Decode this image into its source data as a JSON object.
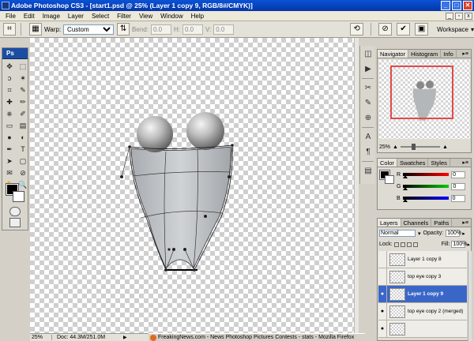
{
  "window": {
    "title": "Adobe Photoshop CS3 - [start1.psd @ 25% (Layer 1 copy 9, RGB/8#/CMYK)]",
    "buttons": [
      "_",
      "□",
      "✕"
    ]
  },
  "menu": {
    "items": [
      "File",
      "Edit",
      "Image",
      "Layer",
      "Select",
      "Filter",
      "View",
      "Window",
      "Help"
    ]
  },
  "options": {
    "warp_label": "Warp:",
    "warp_value": "Custom",
    "bend_label": "Bend:",
    "bend_value": "0.0",
    "h_label": "H:",
    "h_value": "0.0",
    "v_label": "V:",
    "v_value": "0.0",
    "workspace_label": "Workspace"
  },
  "toolbox": {
    "logo": "Ps",
    "tools": [
      "move-icon",
      "marquee-icon",
      "lasso-icon",
      "magic-wand-icon",
      "crop-icon",
      "slice-icon",
      "healing-icon",
      "brush-icon",
      "stamp-icon",
      "history-brush-icon",
      "eraser-icon",
      "gradient-icon",
      "blur-icon",
      "dodge-icon",
      "pen-icon",
      "type-icon",
      "path-select-icon",
      "shape-icon",
      "notes-icon",
      "eyedropper-icon",
      "hand-icon",
      "zoom-icon"
    ],
    "glyphs": [
      "✥",
      "⬚",
      "ↄ",
      "✶",
      "⌗",
      "✎",
      "✚",
      "✏",
      "⎈",
      "✐",
      "▭",
      "▤",
      "●",
      "◐",
      "✒",
      "T",
      "➤",
      "▢",
      "✉",
      "⊘",
      "✋",
      "🔍"
    ]
  },
  "status": {
    "zoom": "25%",
    "doc": "Doc: 44.3M/251.0M"
  },
  "taskbar": {
    "firefox_title": "FreakingNews.com - News Photoshop Pictures Contests - stats - Mozilla Firefox"
  },
  "navigator": {
    "tabs": [
      "Navigator",
      "Histogram",
      "Info"
    ],
    "zoom": "25%"
  },
  "color": {
    "tabs": [
      "Color",
      "Swatches",
      "Styles"
    ],
    "r_label": "R",
    "g_label": "G",
    "b_label": "B",
    "r_value": "0",
    "g_value": "0",
    "b_value": "0"
  },
  "layers": {
    "tabs": [
      "Layers",
      "Channels",
      "Paths"
    ],
    "blend_mode": "Normal",
    "opacity_label": "Opacity:",
    "opacity_value": "100%",
    "lock_label": "Lock:",
    "fill_label": "Fill:",
    "fill_value": "100%",
    "items": [
      {
        "name": "Layer 1 copy 8",
        "visible": false,
        "selected": false
      },
      {
        "name": "top eye copy 3",
        "visible": false,
        "selected": false
      },
      {
        "name": "Layer 1 copy 9",
        "visible": true,
        "selected": true
      },
      {
        "name": "top eye copy 2 (merged)",
        "visible": true,
        "selected": false
      },
      {
        "name": "",
        "visible": true,
        "selected": false
      }
    ]
  },
  "colors": {
    "accent": "#3a66c8",
    "titlebar": "#0a52d6",
    "nav_frame": "#e04a4a"
  }
}
